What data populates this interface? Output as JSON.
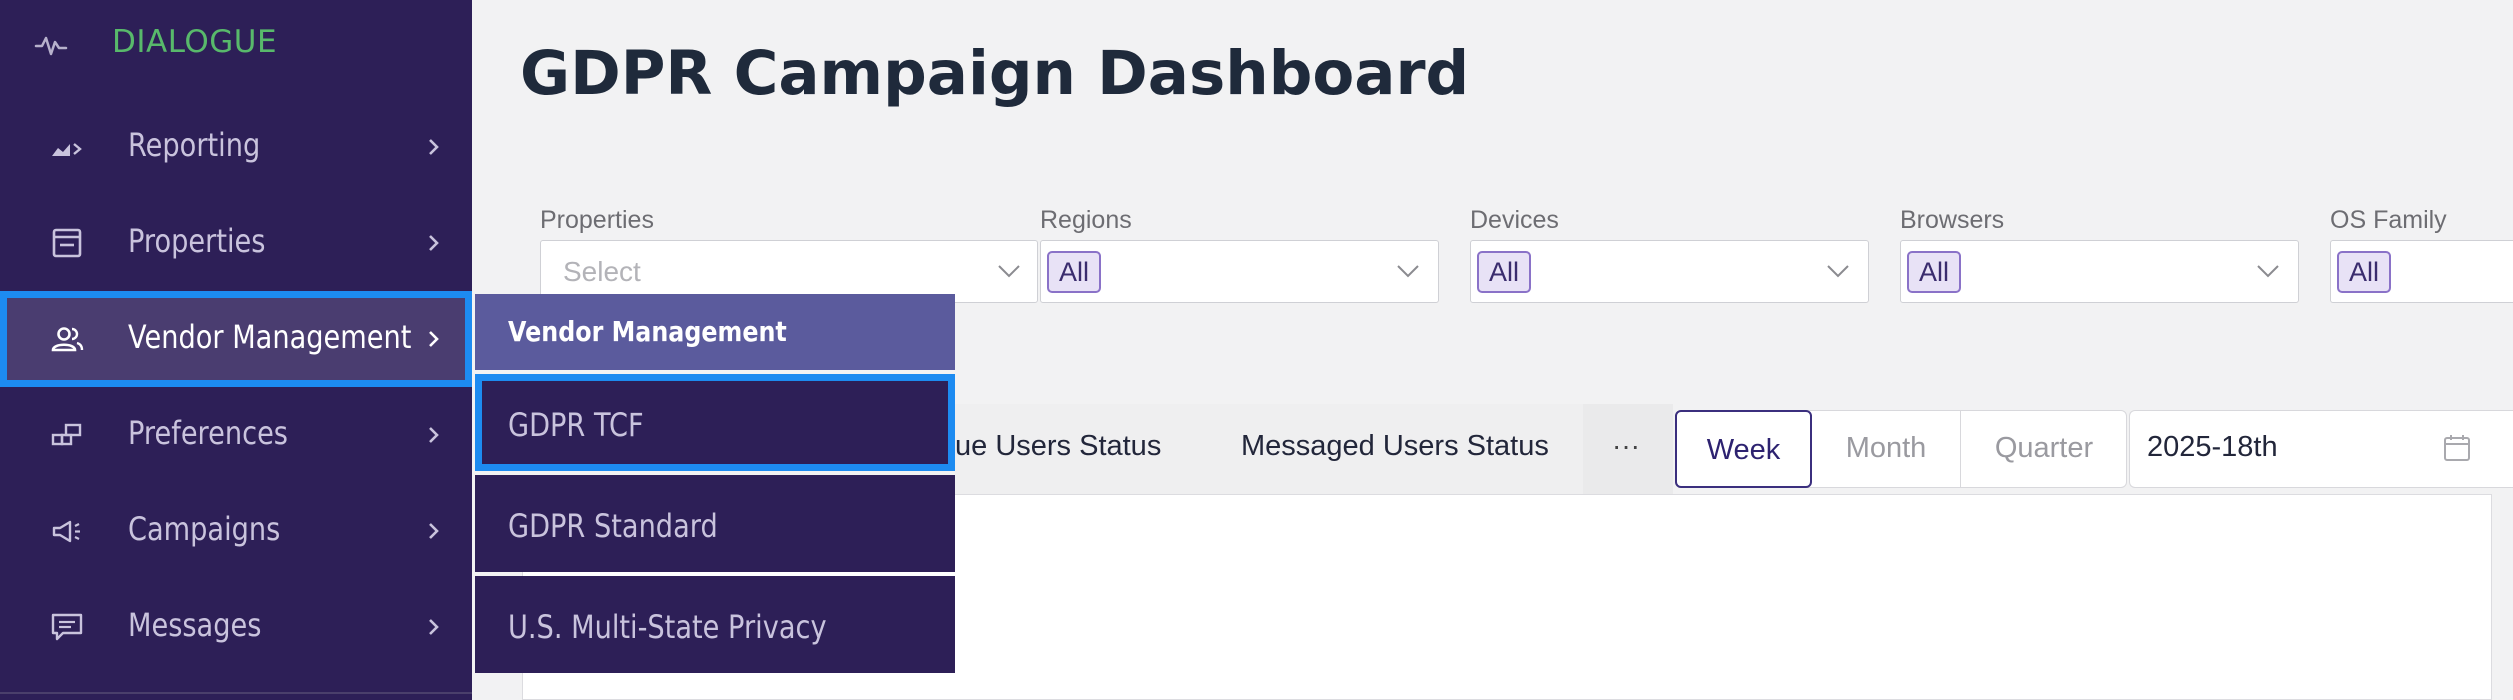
{
  "brand": {
    "name": "DIALOGUE",
    "icon": "activity-pulse-icon",
    "color": "#58b96b"
  },
  "sidebar": {
    "background": "#2d1f57",
    "items": [
      {
        "label": "Reporting",
        "icon": "reporting-chart-icon"
      },
      {
        "label": "Properties",
        "icon": "properties-window-icon"
      },
      {
        "label": "Vendor Management",
        "icon": "users-icon",
        "active": true
      },
      {
        "label": "Preferences",
        "icon": "preferences-blocks-icon"
      },
      {
        "label": "Campaigns",
        "icon": "megaphone-icon"
      },
      {
        "label": "Messages",
        "icon": "message-icon"
      }
    ]
  },
  "submenu": {
    "header": "Vendor Management",
    "items": [
      {
        "label": "GDPR TCF",
        "active": true
      },
      {
        "label": "GDPR Standard"
      },
      {
        "label": "U.S. Multi-State Privacy"
      }
    ]
  },
  "page": {
    "title": "GDPR Campaign Dashboard"
  },
  "filters": [
    {
      "label": "Properties",
      "placeholder": "Select"
    },
    {
      "label": "Regions",
      "value": "All"
    },
    {
      "label": "Devices",
      "value": "All"
    },
    {
      "label": "Browsers",
      "value": "All"
    },
    {
      "label": "OS Family",
      "value": "All"
    }
  ],
  "tabs": {
    "partial_tab": "ue Users Status",
    "messaged_tab": "Messaged Users Status",
    "more": "···"
  },
  "period": {
    "options": [
      "Week",
      "Month",
      "Quarter"
    ],
    "selected": "Week"
  },
  "date": {
    "value": "2025-18th",
    "icon": "calendar-icon"
  },
  "colors": {
    "accent": "#1d8bf1",
    "submenu_header": "#5b5b9d",
    "tag_border": "#8a72c8"
  }
}
